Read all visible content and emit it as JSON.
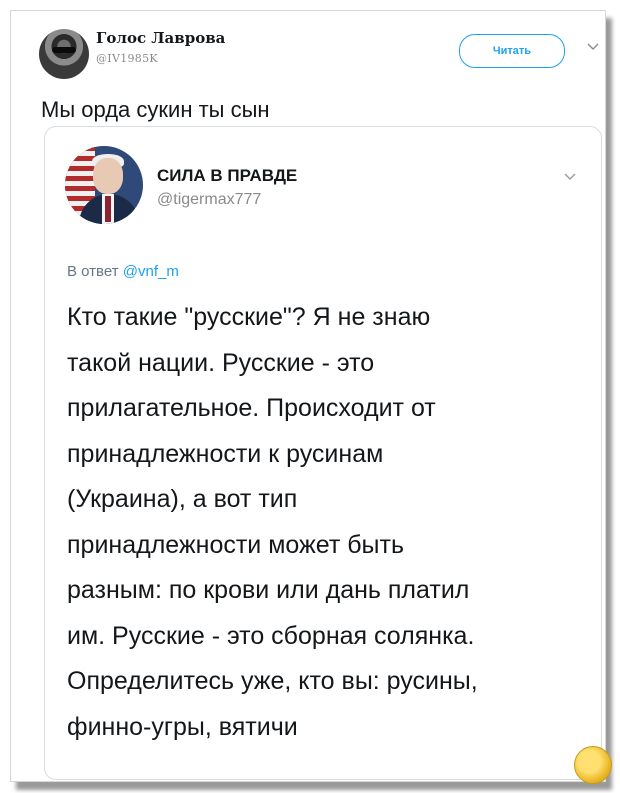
{
  "outer_tweet": {
    "author_name": "Голос Лаврова",
    "author_handle": "@IV1985K",
    "follow_label": "Читать",
    "text": "Мы орда сукин ты сын"
  },
  "quoted_tweet": {
    "author_name": "СИЛА В ПРАВДЕ",
    "author_handle": "@tigermax777",
    "reply_prefix": "В ответ",
    "reply_mention": "@vnf_m",
    "body_lines": [
      "Кто такие \"русские\"? Я не знаю",
      "такой нации. Русские - это",
      "прилагательное. Происходит от",
      "принадлежности к русинам",
      "(Украина), а вот тип",
      "принадлежности может быть",
      "разным: по крови или дань платил",
      "им. Русские - это сборная солянка.",
      "Определитесь уже, кто вы: русины,",
      "финно-угры, вятичи"
    ]
  },
  "icons": {
    "chevron": "chevron-down-icon"
  },
  "colors": {
    "accent": "#1da1f2",
    "text": "#14171a",
    "muted": "#8a8a8a"
  }
}
